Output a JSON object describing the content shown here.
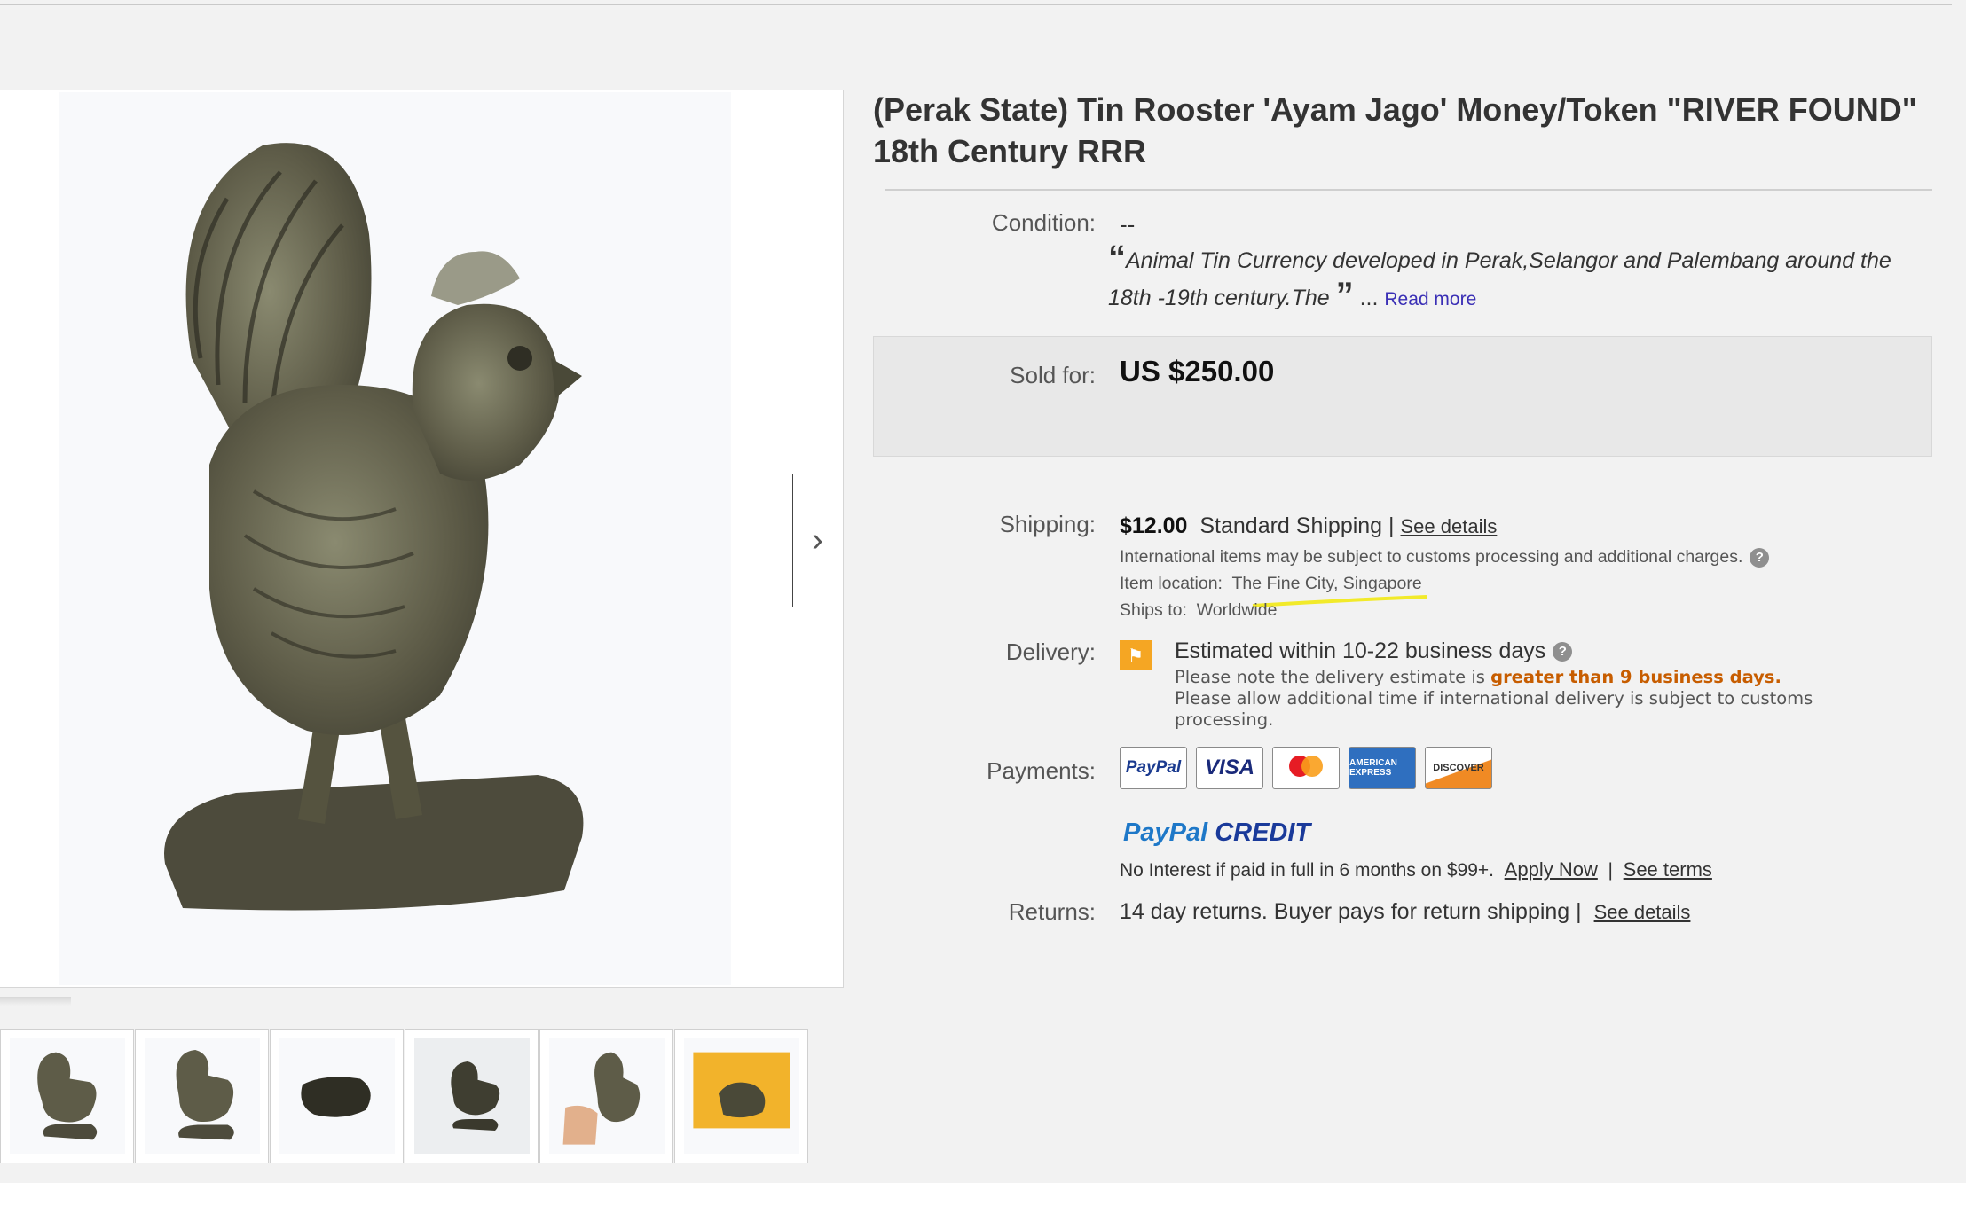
{
  "listing": {
    "title": "(Perak State) Tin Rooster 'Ayam Jago' Money/Token \"RIVER FOUND\" 18th Century RRR",
    "condition_label": "Condition:",
    "condition_value": "--",
    "description_quote": "Animal Tin Currency developed in Perak,Selangor and Palembang around the 18th -19th century.The",
    "open_quote": "“",
    "close_quote": "”",
    "ellipsis": "...",
    "read_more": "Read more",
    "sold_label": "Sold for:",
    "sold_price": "US $250.00"
  },
  "shipping": {
    "label": "Shipping:",
    "cost": "$12.00",
    "method": "Standard Shipping",
    "separator": "|",
    "see_details": "See details",
    "customs_note": "International items may be subject to customs processing and additional charges.",
    "help_icon": "?",
    "location_label": "Item location:",
    "location_value": "The Fine City, Singapore",
    "ships_to_label": "Ships to:",
    "ships_to_value": "Worldwide"
  },
  "delivery": {
    "label": "Delivery:",
    "flag_icon": "⚑",
    "estimate": "Estimated within 10-22 business days",
    "note_prefix": "Please note the delivery estimate is",
    "note_emphasis": "greater than 9 business days.",
    "note_extra": "Please allow additional time if international delivery is subject to customs processing."
  },
  "payments": {
    "label": "Payments:",
    "cards": [
      "PayPal",
      "VISA",
      "Mastercard",
      "AMERICAN EXPRESS",
      "DISCOVER"
    ],
    "paypal_credit_a": "PayPal",
    "paypal_credit_b": "CREDIT",
    "credit_note": "No Interest if paid in full in 6 months on $99+.",
    "apply_now": "Apply Now",
    "divider": "|",
    "see_terms": "See terms"
  },
  "returns": {
    "label": "Returns:",
    "text": "14 day returns. Buyer pays for return shipping",
    "separator": "|",
    "see_details": "See details"
  },
  "gallery": {
    "next_icon": "›",
    "thumbnail_count": 6
  },
  "colors": {
    "highlight": "#f2ea2a",
    "warning": "#c75d00",
    "flag": "#f5a623",
    "paypal_dark": "#1a3a9a",
    "link_purple": "#3a2fb5"
  }
}
